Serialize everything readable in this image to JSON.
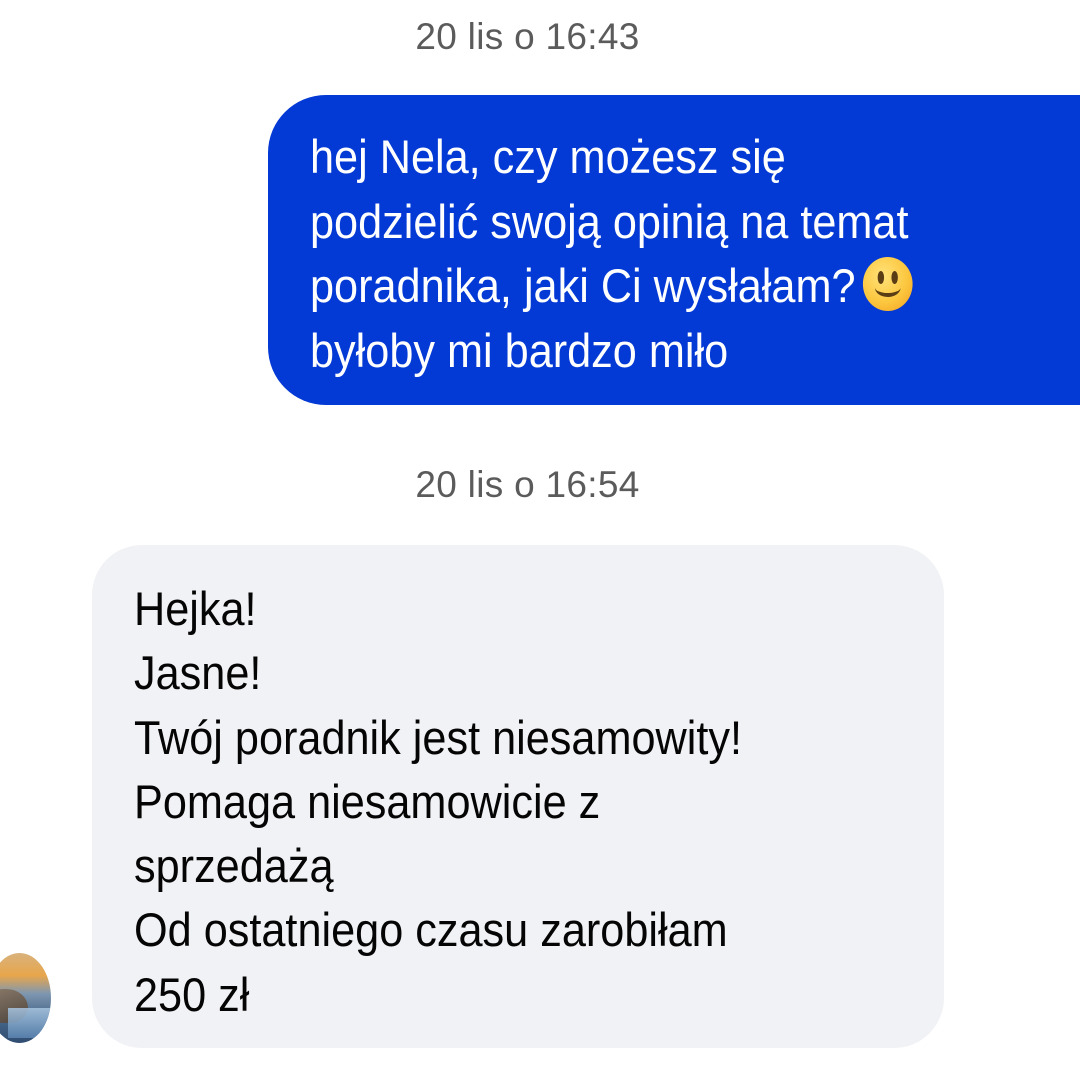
{
  "conversation": {
    "timestamps": [
      "20 lis o 16:43",
      "20 lis o 16:54"
    ],
    "outgoing_message": {
      "lines": [
        "hej Nela, czy możesz się",
        "podzielić swoją opinią na temat",
        "poradnika, jaki Ci wysłałam?",
        "byłoby mi bardzo miło"
      ],
      "emoji": "slightly-smiling-face",
      "bubble_color": "#0339d4",
      "text_color": "#ffffff"
    },
    "incoming_message": {
      "lines": [
        "Hejka!",
        "Jasne!",
        "Twój poradnik jest niesamowity!",
        "Pomaga niesamowicie z",
        "sprzedażą",
        "Od ostatniego czasu zarobiłam",
        "250 zł"
      ],
      "bubble_color": "#f1f2f5",
      "text_color": "#050505"
    },
    "sender_avatar": "sender-avatar-photo"
  }
}
